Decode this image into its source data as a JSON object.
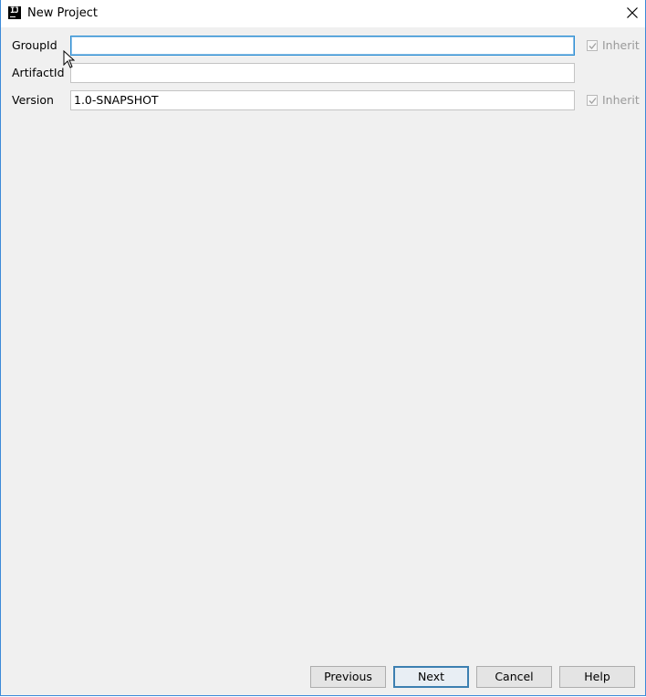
{
  "window": {
    "title": "New Project",
    "app_icon": "intellij-idea-icon",
    "close_icon": "close-icon"
  },
  "form": {
    "group_id": {
      "label": "GroupId",
      "value": "",
      "inherit_label": "Inherit",
      "inherit_checked": true
    },
    "artifact_id": {
      "label": "ArtifactId",
      "value": ""
    },
    "version": {
      "label": "Version",
      "value": "1.0-SNAPSHOT",
      "inherit_label": "Inherit",
      "inherit_checked": true
    }
  },
  "buttons": {
    "previous": "Previous",
    "next": "Next",
    "cancel": "Cancel",
    "help": "Help"
  },
  "colors": {
    "focus_border": "#2e8fd3",
    "window_border": "#3c8ad8",
    "default_button_border": "#3c7fb1"
  }
}
